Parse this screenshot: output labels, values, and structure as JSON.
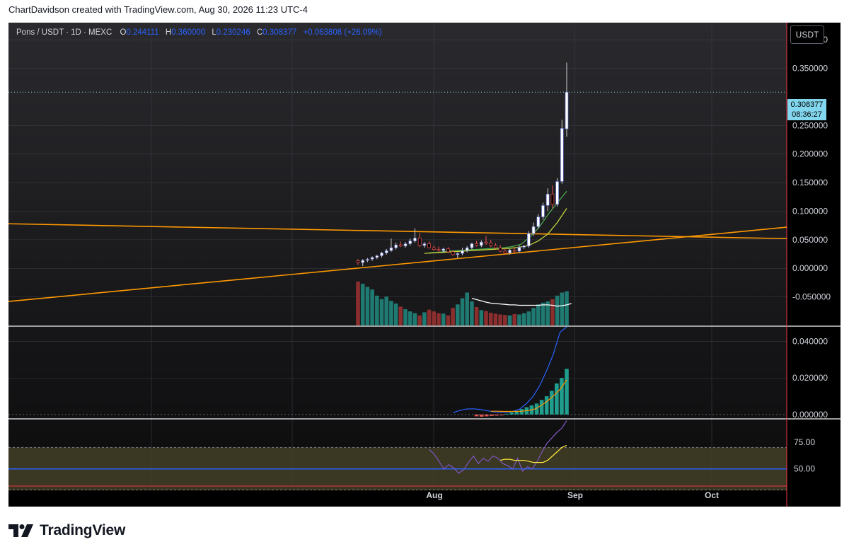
{
  "header": {
    "text": "ChartDavidson created with TradingView.com, Aug 30, 2026 11:23 UTC-4"
  },
  "legend": {
    "symbol": "Pons / USDT · 1D · MEXC",
    "o_label": "O",
    "o_value": "0.244111",
    "h_label": "H",
    "h_value": "0.360000",
    "l_label": "L",
    "l_value": "0.230246",
    "c_label": "C",
    "c_value": "0.308377",
    "change": "+0.063808 (+26.09%)"
  },
  "currency_button": "USDT",
  "price_tag": {
    "price": "0.308377",
    "countdown": "08:36:27"
  },
  "footer": {
    "brand": "TradingView"
  },
  "colors": {
    "background": "#000000",
    "grid": "#1e222d",
    "up": "#ffffff",
    "down": "#ef5350",
    "volume_up": "#26a69a",
    "volume_down": "#ef5350",
    "trendline": "#ff9800",
    "ma_green": "#4caf50",
    "ma_yellow": "#cddc39",
    "ma_orange": "#ff9800",
    "volume_ma": "#ffffff",
    "macd_blue": "#2962ff",
    "rsi_purple": "#7e57c2",
    "rsi_ma": "#ffeb3b",
    "rsi_band": "#4a4529",
    "rsi_mid": "#2962ff",
    "separator": "#f23645"
  },
  "chart_data": [
    {
      "type": "candlestick",
      "title": "Pons / USDT · 1D · MEXC",
      "x_ticks": [
        "Aug",
        "Sep",
        "Oct"
      ],
      "y_ticks": [
        "0.400000",
        "0.350000",
        "0.250000",
        "0.200000",
        "0.150000",
        "0.100000",
        "0.050000",
        "0.000000",
        "-0.050000"
      ],
      "ylim": [
        -0.1,
        0.43
      ],
      "grid": true,
      "last_price": 0.308377,
      "candles": [
        {
          "o": 0.013,
          "h": 0.016,
          "l": 0.006,
          "c": 0.01
        },
        {
          "o": 0.01,
          "h": 0.016,
          "l": 0.004,
          "c": 0.014
        },
        {
          "o": 0.014,
          "h": 0.018,
          "l": 0.011,
          "c": 0.016
        },
        {
          "o": 0.016,
          "h": 0.021,
          "l": 0.013,
          "c": 0.019
        },
        {
          "o": 0.019,
          "h": 0.024,
          "l": 0.016,
          "c": 0.022
        },
        {
          "o": 0.022,
          "h": 0.029,
          "l": 0.019,
          "c": 0.027
        },
        {
          "o": 0.027,
          "h": 0.034,
          "l": 0.024,
          "c": 0.031
        },
        {
          "o": 0.031,
          "h": 0.052,
          "l": 0.029,
          "c": 0.036
        },
        {
          "o": 0.036,
          "h": 0.045,
          "l": 0.033,
          "c": 0.041
        },
        {
          "o": 0.041,
          "h": 0.047,
          "l": 0.037,
          "c": 0.039
        },
        {
          "o": 0.039,
          "h": 0.046,
          "l": 0.036,
          "c": 0.043
        },
        {
          "o": 0.043,
          "h": 0.052,
          "l": 0.04,
          "c": 0.048
        },
        {
          "o": 0.048,
          "h": 0.07,
          "l": 0.045,
          "c": 0.053
        },
        {
          "o": 0.053,
          "h": 0.062,
          "l": 0.037,
          "c": 0.04
        },
        {
          "o": 0.04,
          "h": 0.046,
          "l": 0.036,
          "c": 0.043
        },
        {
          "o": 0.043,
          "h": 0.047,
          "l": 0.035,
          "c": 0.036
        },
        {
          "o": 0.036,
          "h": 0.04,
          "l": 0.031,
          "c": 0.033
        },
        {
          "o": 0.033,
          "h": 0.038,
          "l": 0.029,
          "c": 0.031
        },
        {
          "o": 0.031,
          "h": 0.036,
          "l": 0.027,
          "c": 0.034
        },
        {
          "o": 0.034,
          "h": 0.037,
          "l": 0.027,
          "c": 0.029
        },
        {
          "o": 0.029,
          "h": 0.032,
          "l": 0.022,
          "c": 0.024
        },
        {
          "o": 0.024,
          "h": 0.028,
          "l": 0.018,
          "c": 0.026
        },
        {
          "o": 0.026,
          "h": 0.036,
          "l": 0.023,
          "c": 0.031
        },
        {
          "o": 0.031,
          "h": 0.039,
          "l": 0.028,
          "c": 0.036
        },
        {
          "o": 0.036,
          "h": 0.045,
          "l": 0.033,
          "c": 0.043
        },
        {
          "o": 0.043,
          "h": 0.048,
          "l": 0.038,
          "c": 0.04
        },
        {
          "o": 0.04,
          "h": 0.049,
          "l": 0.037,
          "c": 0.046
        },
        {
          "o": 0.046,
          "h": 0.057,
          "l": 0.041,
          "c": 0.044
        },
        {
          "o": 0.044,
          "h": 0.05,
          "l": 0.037,
          "c": 0.04
        },
        {
          "o": 0.04,
          "h": 0.044,
          "l": 0.034,
          "c": 0.036
        },
        {
          "o": 0.036,
          "h": 0.041,
          "l": 0.028,
          "c": 0.03
        },
        {
          "o": 0.03,
          "h": 0.035,
          "l": 0.024,
          "c": 0.027
        },
        {
          "o": 0.027,
          "h": 0.034,
          "l": 0.024,
          "c": 0.032
        },
        {
          "o": 0.032,
          "h": 0.036,
          "l": 0.027,
          "c": 0.03
        },
        {
          "o": 0.03,
          "h": 0.04,
          "l": 0.027,
          "c": 0.037
        },
        {
          "o": 0.037,
          "h": 0.041,
          "l": 0.034,
          "c": 0.039
        },
        {
          "o": 0.039,
          "h": 0.065,
          "l": 0.036,
          "c": 0.061
        },
        {
          "o": 0.061,
          "h": 0.08,
          "l": 0.057,
          "c": 0.073
        },
        {
          "o": 0.073,
          "h": 0.095,
          "l": 0.07,
          "c": 0.09
        },
        {
          "o": 0.09,
          "h": 0.115,
          "l": 0.085,
          "c": 0.11
        },
        {
          "o": 0.11,
          "h": 0.14,
          "l": 0.1,
          "c": 0.13
        },
        {
          "o": 0.13,
          "h": 0.145,
          "l": 0.105,
          "c": 0.112
        },
        {
          "o": 0.112,
          "h": 0.158,
          "l": 0.108,
          "c": 0.152
        },
        {
          "o": 0.152,
          "h": 0.26,
          "l": 0.148,
          "c": 0.245
        },
        {
          "o": 0.244111,
          "h": 0.36,
          "l": 0.230246,
          "c": 0.308377
        }
      ],
      "moving_averages": [
        {
          "color": "green",
          "values": [
            0.027,
            0.028,
            0.03,
            0.031,
            0.032,
            0.033,
            0.034,
            0.035,
            0.036,
            0.038,
            0.042,
            0.055,
            0.072,
            0.095,
            0.115,
            0.135
          ]
        },
        {
          "color": "yellow",
          "values": [
            0.026,
            0.027,
            0.028,
            0.029,
            0.03,
            0.031,
            0.032,
            0.033,
            0.034,
            0.035,
            0.037,
            0.04,
            0.048,
            0.06,
            0.08,
            0.105
          ]
        }
      ],
      "trendlines": [
        {
          "from": [
            0,
            0.078
          ],
          "to": [
            1,
            0.052
          ]
        },
        {
          "from": [
            0,
            -0.058
          ],
          "to": [
            1,
            0.072
          ]
        }
      ],
      "volume": [
        1.0,
        0.95,
        0.88,
        0.82,
        0.68,
        0.6,
        0.66,
        0.56,
        0.5,
        0.43,
        0.37,
        0.32,
        0.28,
        0.23,
        0.3,
        0.36,
        0.32,
        0.28,
        0.27,
        0.23,
        0.4,
        0.48,
        0.62,
        0.75,
        0.55,
        0.42,
        0.35,
        0.33,
        0.29,
        0.27,
        0.25,
        0.24,
        0.23,
        0.26,
        0.25,
        0.28,
        0.32,
        0.4,
        0.48,
        0.52,
        0.55,
        0.6,
        0.68,
        0.75,
        0.78
      ],
      "volume_ma": [
        0.62,
        0.59,
        0.56,
        0.53,
        0.51,
        0.5,
        0.49,
        0.48,
        0.47,
        0.47,
        0.46,
        0.46,
        0.46,
        0.46,
        0.46,
        0.47,
        0.47,
        0.46,
        0.44,
        0.45,
        0.47,
        0.5
      ]
    },
    {
      "type": "bar",
      "title": "",
      "y_ticks": [
        "0.040000",
        "0.020000",
        "0.000000"
      ],
      "ylim": [
        -0.002,
        0.048
      ],
      "histogram": [
        -0.001,
        -0.0012,
        -0.001,
        -0.0008,
        -0.0006,
        -0.0005,
        0.0004,
        0.0012,
        0.002,
        0.003,
        0.004,
        0.005,
        0.006,
        0.008,
        0.01,
        0.013,
        0.017,
        0.02,
        0.025
      ],
      "series": [
        {
          "name": "",
          "color": "blue",
          "values": [
            0.001,
            0.0022,
            0.003,
            0.0031,
            0.0028,
            0.0022,
            0.0015,
            0.0012,
            0.0012,
            0.0018,
            0.003,
            0.006,
            0.01,
            0.016,
            0.024,
            0.033,
            0.045,
            0.06
          ]
        },
        {
          "name": "",
          "color": "orange",
          "values": [
            0.0018,
            0.0018,
            0.0017,
            0.0017,
            0.0017,
            0.0018,
            0.0022,
            0.003,
            0.005,
            0.0075,
            0.0105,
            0.014,
            0.019
          ]
        }
      ]
    },
    {
      "type": "line",
      "title": "",
      "y_ticks": [
        "75.00",
        "50.00"
      ],
      "ylim": [
        34,
        96
      ],
      "band": [
        30,
        70
      ],
      "midline": 50,
      "series": [
        {
          "name": "",
          "color": "purple",
          "values": [
            68,
            64,
            57,
            50,
            54,
            51,
            46,
            49,
            56,
            62,
            55,
            60,
            57,
            62,
            60,
            55,
            53,
            50,
            60,
            48,
            52,
            50,
            57,
            66,
            74,
            79,
            84,
            88,
            95
          ]
        },
        {
          "name": "",
          "color": "yellow",
          "values": [
            58,
            59,
            59,
            58,
            58,
            58,
            57,
            56,
            56,
            56,
            58,
            62,
            66,
            70,
            72
          ]
        }
      ]
    }
  ]
}
